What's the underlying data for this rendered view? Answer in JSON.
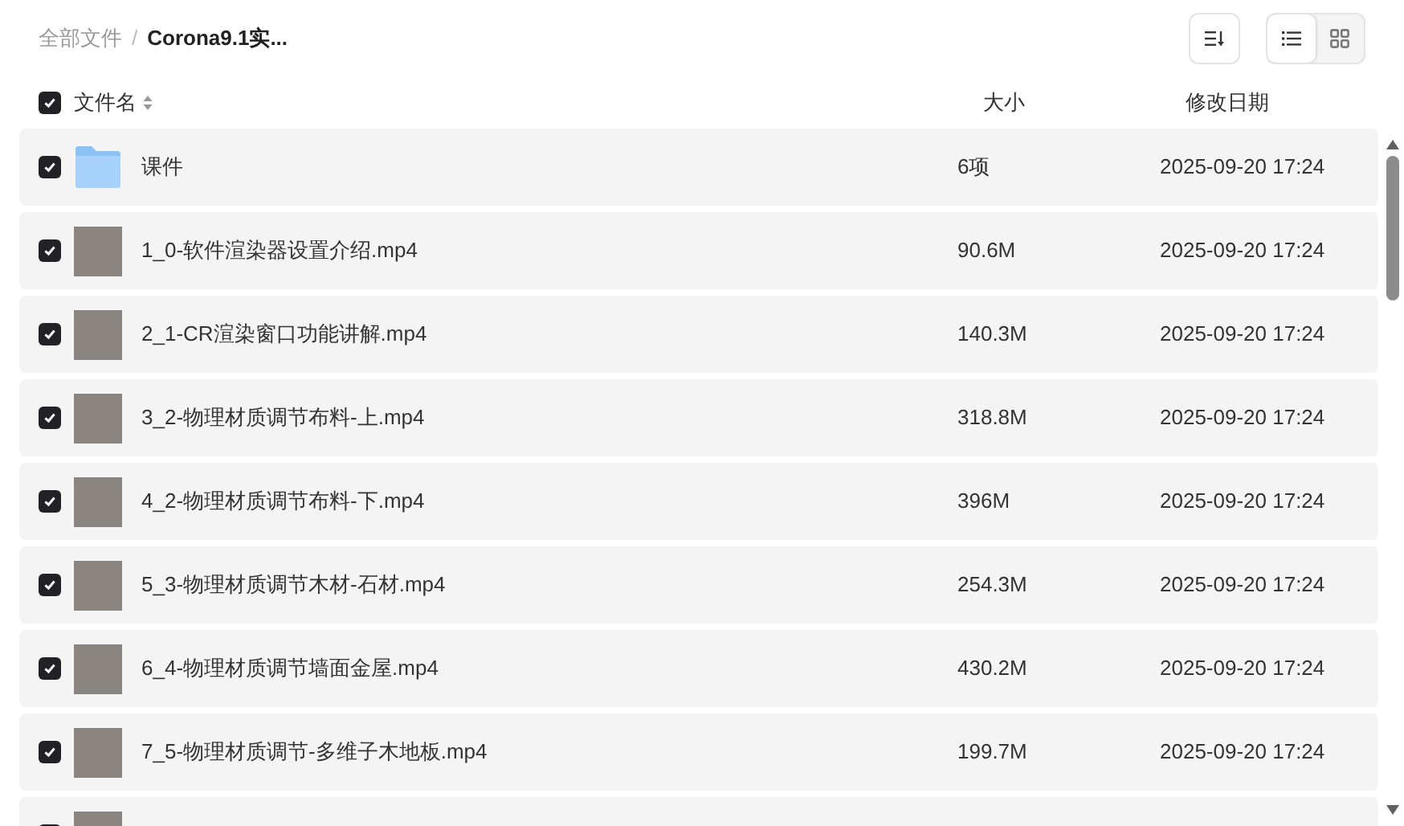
{
  "breadcrumb": {
    "separator": "/",
    "items": [
      {
        "label": "全部文件",
        "current": false
      },
      {
        "label": "Corona9.1实...",
        "current": true
      }
    ]
  },
  "toolbar": {
    "views": [
      {
        "kind": "list",
        "selected": true
      },
      {
        "kind": "grid",
        "selected": false
      }
    ]
  },
  "header": {
    "checked": true,
    "columns": [
      {
        "label": "文件名",
        "kind": "sortable"
      },
      {
        "label": "大小",
        "kind": "plain"
      },
      {
        "label": "修改日期",
        "kind": "plain"
      }
    ]
  },
  "rows": [
    {
      "kind": "folder",
      "checked": true,
      "name": "课件",
      "size": "6项",
      "date": "2025-09-20 17:24"
    },
    {
      "kind": "video",
      "checked": true,
      "name": "1_0-软件渲染器设置介绍.mp4",
      "size": "90.6M",
      "date": "2025-09-20 17:24"
    },
    {
      "kind": "video",
      "checked": true,
      "name": "2_1-CR渲染窗口功能讲解.mp4",
      "size": "140.3M",
      "date": "2025-09-20 17:24"
    },
    {
      "kind": "video",
      "checked": true,
      "name": "3_2-物理材质调节布料-上.mp4",
      "size": "318.8M",
      "date": "2025-09-20 17:24"
    },
    {
      "kind": "video",
      "checked": true,
      "name": "4_2-物理材质调节布料-下.mp4",
      "size": "396M",
      "date": "2025-09-20 17:24"
    },
    {
      "kind": "video",
      "checked": true,
      "name": "5_3-物理材质调节木材-石材.mp4",
      "size": "254.3M",
      "date": "2025-09-20 17:24"
    },
    {
      "kind": "video",
      "checked": true,
      "name": "6_4-物理材质调节墙面金屋.mp4",
      "size": "430.2M",
      "date": "2025-09-20 17:24"
    },
    {
      "kind": "video",
      "checked": true,
      "name": "7_5-物理材质调节-多维子木地板.mp4",
      "size": "199.7M",
      "date": "2025-09-20 17:24"
    },
    {
      "kind": "video",
      "checked": true
    }
  ]
}
